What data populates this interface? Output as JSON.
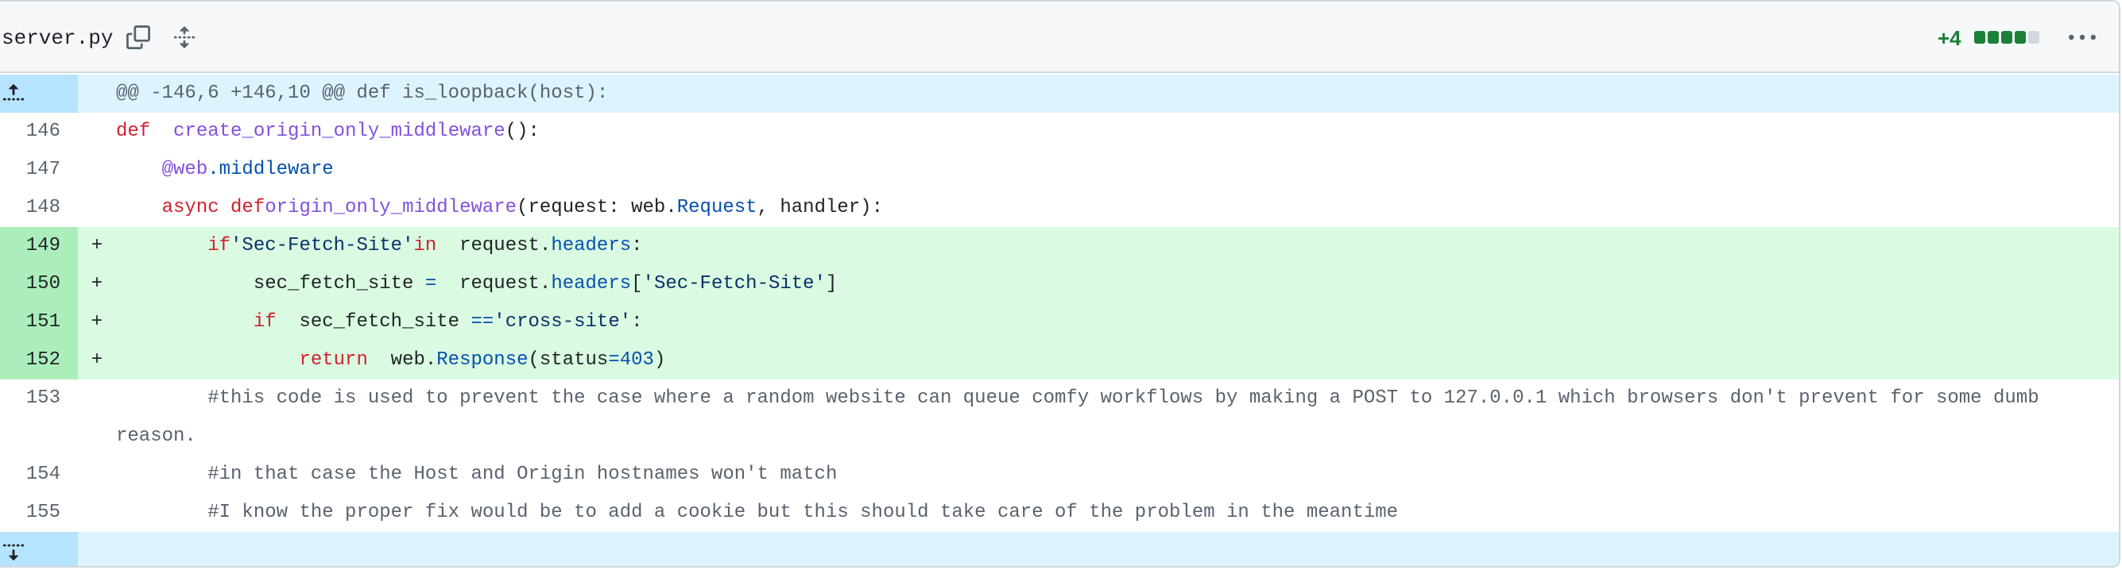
{
  "file": {
    "name": "server.py",
    "additions": "+4",
    "stat_blocks": [
      "#1a7f37",
      "#1a7f37",
      "#1a7f37",
      "#1a7f37",
      "#d0d7de"
    ]
  },
  "colors": {
    "added_bg": "#dafbe1",
    "added_gutter": "#aceebb",
    "hunk_bg": "#ddf4ff",
    "hunk_gutter": "#b6e3ff",
    "keyword": "#cf222e",
    "function": "#8250df",
    "attribute": "#0550ae"
  },
  "icons": {
    "copy": "copy-icon",
    "expand_all": "unfold-icon",
    "more": "kebab-horizontal-icon",
    "expand_up": "expand-up-icon",
    "expand_down": "expand-down-icon"
  },
  "hunk": {
    "header": "@@ -146,6 +146,10 @@ def is_loopback(host):"
  },
  "lines": [
    {
      "num": "146",
      "type": "context",
      "tokens": [
        [
          "kw",
          "def"
        ],
        [
          "",
          "  "
        ],
        [
          "fn",
          "create_origin_only_middleware"
        ],
        [
          "",
          "():"
        ]
      ]
    },
    {
      "num": "147",
      "type": "context",
      "tokens": [
        [
          "",
          "    "
        ],
        [
          "fn",
          "@web"
        ],
        [
          "",
          ""
        ],
        [
          "at",
          ".middleware"
        ]
      ]
    },
    {
      "num": "148",
      "type": "context",
      "tokens": [
        [
          "",
          "    "
        ],
        [
          "kw",
          "async def"
        ],
        [
          "",
          ""
        ],
        [
          "fn",
          "origin_only_middleware"
        ],
        [
          "",
          "(request: web."
        ],
        [
          "at",
          "Request"
        ],
        [
          "",
          ", handler):"
        ]
      ]
    },
    {
      "num": "149",
      "type": "add",
      "sign": "+",
      "tokens": [
        [
          "",
          "        "
        ],
        [
          "kw",
          "if"
        ],
        [
          "",
          ""
        ],
        [
          "str",
          "'Sec-Fetch-Site'"
        ],
        [
          "",
          ""
        ],
        [
          "kw",
          "in"
        ],
        [
          "",
          "  request."
        ],
        [
          "at",
          "headers"
        ],
        [
          "",
          ":"
        ]
      ]
    },
    {
      "num": "150",
      "type": "add",
      "sign": "+",
      "tokens": [
        [
          "",
          "            sec_fetch_site "
        ],
        [
          "at",
          "="
        ],
        [
          "",
          "  request."
        ],
        [
          "at",
          "headers"
        ],
        [
          "",
          "["
        ],
        [
          "str",
          "'Sec-Fetch-Site'"
        ],
        [
          "",
          "]"
        ]
      ]
    },
    {
      "num": "151",
      "type": "add",
      "sign": "+",
      "tokens": [
        [
          "",
          "            "
        ],
        [
          "kw",
          "if"
        ],
        [
          "",
          "  sec_fetch_site "
        ],
        [
          "at",
          "=="
        ],
        [
          "",
          ""
        ],
        [
          "str",
          "'cross-site'"
        ],
        [
          "",
          ":"
        ]
      ]
    },
    {
      "num": "152",
      "type": "add",
      "sign": "+",
      "tokens": [
        [
          "",
          "                "
        ],
        [
          "kw",
          "return"
        ],
        [
          "",
          "  web."
        ],
        [
          "at",
          "Response"
        ],
        [
          "",
          "(status"
        ],
        [
          "at",
          "=403"
        ],
        [
          "",
          ")"
        ]
      ]
    },
    {
      "num": "153",
      "type": "context",
      "tokens": [
        [
          "cm",
          "        #this code is used to prevent the case where a random website can queue comfy workflows by making a POST to 127.0.0.1 which browsers don't prevent for some dumb reason."
        ]
      ]
    },
    {
      "num": "154",
      "type": "context",
      "tokens": [
        [
          "cm",
          "        #in that case the Host and Origin hostnames won't match"
        ]
      ]
    },
    {
      "num": "155",
      "type": "context",
      "tokens": [
        [
          "cm",
          "        #I know the proper fix would be to add a cookie but this should take care of the problem in the meantime"
        ]
      ]
    }
  ]
}
